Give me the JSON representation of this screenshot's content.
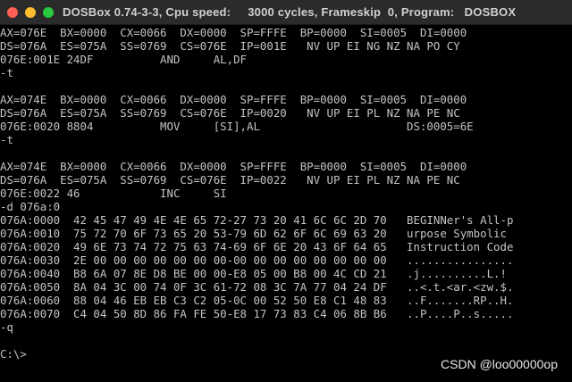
{
  "window": {
    "title": "DOSBox 0.74-3-3, Cpu speed:     3000 cycles, Frameskip  0, Program:   DOSBOX"
  },
  "console": {
    "lines": [
      "AX=076E  BX=0000  CX=0066  DX=0000  SP=FFFE  BP=0000  SI=0005  DI=0000",
      "DS=076A  ES=075A  SS=0769  CS=076E  IP=001E   NV UP EI NG NZ NA PO CY",
      "076E:001E 24DF          AND     AL,DF",
      "-t",
      "",
      "AX=074E  BX=0000  CX=0066  DX=0000  SP=FFFE  BP=0000  SI=0005  DI=0000",
      "DS=076A  ES=075A  SS=0769  CS=076E  IP=0020   NV UP EI PL NZ NA PE NC",
      "076E:0020 8804          MOV     [SI],AL                      DS:0005=6E",
      "-t",
      "",
      "AX=074E  BX=0000  CX=0066  DX=0000  SP=FFFE  BP=0000  SI=0005  DI=0000",
      "DS=076A  ES=075A  SS=0769  CS=076E  IP=0022   NV UP EI PL NZ NA PE NC",
      "076E:0022 46            INC     SI",
      "-d 076a:0",
      "076A:0000  42 45 47 49 4E 4E 65 72-27 73 20 41 6C 6C 2D 70   BEGINNer's All-p",
      "076A:0010  75 72 70 6F 73 65 20 53-79 6D 62 6F 6C 69 63 20   urpose Symbolic",
      "076A:0020  49 6E 73 74 72 75 63 74-69 6F 6E 20 43 6F 64 65   Instruction Code",
      "076A:0030  2E 00 00 00 00 00 00 00-00 00 00 00 00 00 00 00   ................",
      "076A:0040  B8 6A 07 8E D8 BE 00 00-E8 05 00 B8 00 4C CD 21   .j..........L.!",
      "076A:0050  8A 04 3C 00 74 0F 3C 61-72 08 3C 7A 77 04 24 DF   ..<.t.<ar.<zw.$.",
      "076A:0060  88 04 46 EB EB C3 C2 05-0C 00 52 50 E8 C1 48 83   ..F.......RP..H.",
      "076A:0070  C4 04 50 8D 86 FA FE 50-E8 17 73 83 C4 06 8B B6   ..P....P..s.....",
      "-q",
      "",
      "C:\\>"
    ]
  },
  "watermark": {
    "text": "CSDN @loo00000op"
  }
}
